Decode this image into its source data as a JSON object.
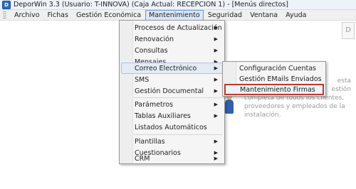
{
  "window": {
    "title": "DeporWin 3.3  (Usuario: T-INNOVA)  (Caja Actual: RECEPCION 1) - [Menús directos]",
    "icon": "app-icon"
  },
  "menubar": {
    "items": [
      "Archivo",
      "Fichas",
      "Gestión Económica",
      "Mantenimiento",
      "Seguridad",
      "Ventana",
      "Ayuda"
    ],
    "active": "Mantenimiento"
  },
  "dropdown": {
    "items": [
      {
        "label": "Procesos de Actualización",
        "submenu": true
      },
      {
        "label": "Renovación",
        "submenu": true
      },
      {
        "label": "Consultas",
        "submenu": true
      },
      {
        "label": "Mensajes",
        "submenu": true
      },
      {
        "label": "Correo Electrónico",
        "submenu": true,
        "hover": true
      },
      {
        "label": "SMS",
        "submenu": true
      },
      {
        "label": "Gestión Documental",
        "submenu": true
      },
      {
        "label": "Parámetros",
        "submenu": true
      },
      {
        "label": "Tablas Auxiliares",
        "submenu": true
      },
      {
        "label": "Listados Automáticos",
        "submenu": false
      },
      {
        "label": "Plantillas",
        "submenu": true
      },
      {
        "label": "Cuestionarios",
        "submenu": true
      },
      {
        "label": "CRM",
        "submenu": true
      }
    ]
  },
  "submenu": {
    "items": [
      "Configuración Cuentas",
      "Gestión EMails Enviados",
      "Mantenimiento Firmas"
    ],
    "highlighted": "Mantenimiento Firmas"
  },
  "background": {
    "logo_letter": "D",
    "text_lines": [
      "esta",
      "estión",
      "completa de todos los clientes,",
      "proveedores y empleados de la",
      "instalación."
    ]
  },
  "colors": {
    "highlight_border": "#c0392b",
    "menu_hover": "#e3ebf5",
    "accent_blue": "#2a6cc7"
  }
}
